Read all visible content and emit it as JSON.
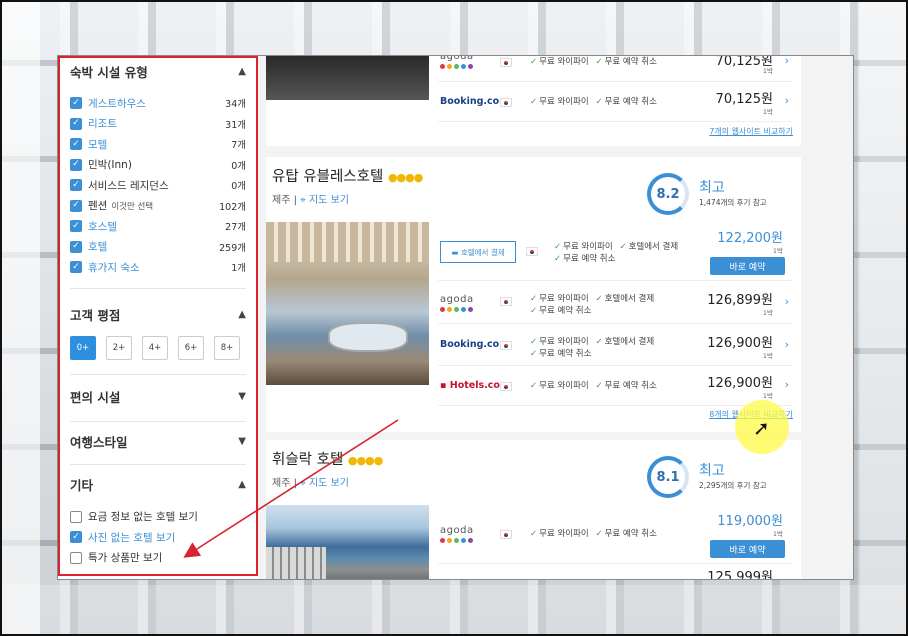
{
  "sidebar": {
    "lodging_type": {
      "title": "숙박 시설 유형",
      "items": [
        {
          "label": "게스트하우스",
          "count": "34개",
          "checked": true,
          "blue": true,
          "hint": ""
        },
        {
          "label": "리조트",
          "count": "31개",
          "checked": true,
          "blue": true,
          "hint": ""
        },
        {
          "label": "모텔",
          "count": "7개",
          "checked": true,
          "blue": true,
          "hint": ""
        },
        {
          "label": "민박(Inn)",
          "count": "0개",
          "checked": true,
          "blue": false,
          "hint": ""
        },
        {
          "label": "서비스드 레지던스",
          "count": "0개",
          "checked": true,
          "blue": false,
          "hint": ""
        },
        {
          "label": "펜션",
          "count": "102개",
          "checked": true,
          "blue": false,
          "hint": "이것만 선택"
        },
        {
          "label": "호스텔",
          "count": "27개",
          "checked": true,
          "blue": true,
          "hint": ""
        },
        {
          "label": "호텔",
          "count": "259개",
          "checked": true,
          "blue": true,
          "hint": ""
        },
        {
          "label": "휴가지 숙소",
          "count": "1개",
          "checked": true,
          "blue": true,
          "hint": ""
        }
      ]
    },
    "rating": {
      "title": "고객 평점",
      "options": [
        "0+",
        "2+",
        "4+",
        "6+",
        "8+"
      ],
      "active": "0+"
    },
    "amenities": {
      "title": "편의 시설"
    },
    "travel_style": {
      "title": "여행스타일"
    },
    "etc": {
      "title": "기타",
      "items": [
        {
          "label": "요금 정보 없는 호텔 보기",
          "checked": false,
          "blue": false
        },
        {
          "label": "사진 없는 호텔 보기",
          "checked": true,
          "blue": true
        },
        {
          "label": "특가 상품만 보기",
          "checked": false,
          "blue": false
        }
      ]
    }
  },
  "top_card": {
    "offers": [
      {
        "brand": "agoda",
        "features": [
          "무료 와이파이",
          "무료 예약 취소"
        ],
        "price": "70,125원",
        "per": "1박"
      },
      {
        "brand": "Booking.com",
        "features": [
          "무료 와이파이",
          "무료 예약 취소"
        ],
        "price": "70,125원",
        "per": "1박"
      }
    ],
    "compare": "7개의 웹사이트 비교하기"
  },
  "hotel1": {
    "name": "유탑 유블레스호텔",
    "stars": "●●●●",
    "location": "제주",
    "map_link": "지도 보기",
    "score": "8.2",
    "score_word": "최고",
    "reviews": "1,474개의 후기 참고",
    "offers": [
      {
        "brand": "호텔에서 결제",
        "features": [
          "무료 와이파이",
          "호텔에서 결제",
          "무료 예약 취소"
        ],
        "price": "122,200원",
        "per": "1박",
        "button": "바로 예약"
      },
      {
        "brand": "agoda",
        "features": [
          "무료 와이파이",
          "호텔에서 결제",
          "무료 예약 취소"
        ],
        "price": "126,899원",
        "per": "1박"
      },
      {
        "brand": "Booking.com",
        "features": [
          "무료 와이파이",
          "호텔에서 결제",
          "무료 예약 취소"
        ],
        "price": "126,900원",
        "per": "1박"
      },
      {
        "brand": "Hotels.com",
        "features": [
          "무료 와이파이",
          "무료 예약 취소"
        ],
        "price": "126,900원",
        "per": "1박"
      }
    ],
    "compare": "8개의 웹사이트 비교하기"
  },
  "hotel2": {
    "name": "휘슬락 호텔",
    "stars": "●●●●",
    "location": "제주",
    "map_link": "지도 보기",
    "score": "8.1",
    "score_word": "최고",
    "reviews": "2,295개의 후기 참고",
    "offers": [
      {
        "brand": "agoda",
        "features": [
          "무료 와이파이",
          "무료 예약 취소"
        ],
        "price": "119,000원",
        "per": "1박",
        "button": "바로 예약"
      },
      {
        "brand": "",
        "features": [],
        "price": "125,999원",
        "per": ""
      }
    ]
  },
  "colors": {
    "accent": "#3b8fd4",
    "highlight_border": "#d9232d",
    "star": "#f2b705"
  }
}
